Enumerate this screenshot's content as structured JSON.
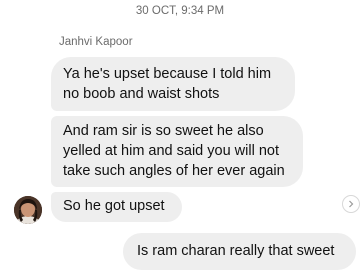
{
  "timestamp": "30 OCT, 9:34 PM",
  "sender_name": "Janhvi Kapoor",
  "messages": [
    {
      "text": "Ya he's upset because I told him no boob and waist shots"
    },
    {
      "text": "And ram sir is so sweet he also yelled at him and said you will not take such angles of her ever again"
    },
    {
      "text": "So he got upset"
    },
    {
      "text": "Is ram charan really that sweet"
    }
  ],
  "icons": {
    "avatar": "contact-avatar-photo",
    "forward": "chevron-right-icon"
  }
}
